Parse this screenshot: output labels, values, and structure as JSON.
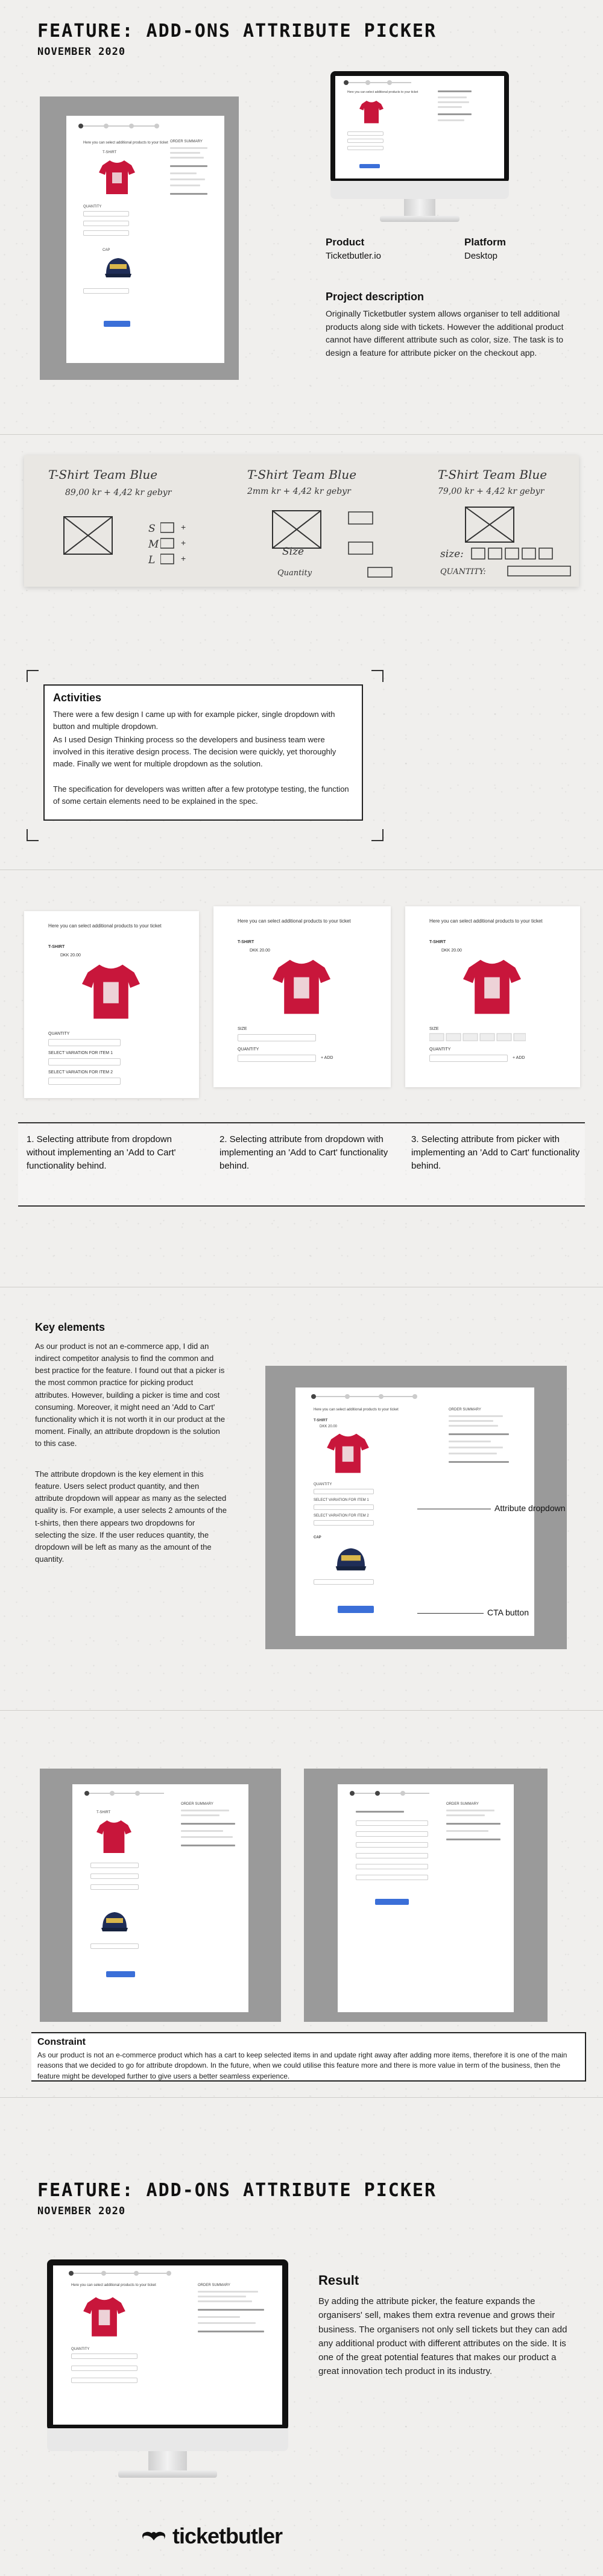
{
  "header": {
    "title": "FEATURE: ADD-ONS ATTRIBUTE PICKER",
    "date": "NOVEMBER 2020"
  },
  "mock": {
    "prompt": "Here you can select additional products to your ticket",
    "product_tshirt": "T-SHIRT",
    "product_tshirt_price": "DKK 20.00",
    "product_cap": "CAP",
    "quantity_label": "QUANTITY",
    "size_label": "SIZE",
    "select_variation": "SELECT VARIATION FOR ITEM 1",
    "select_variation_2": "SELECT VARIATION FOR ITEM 2",
    "add_button": "+ ADD",
    "order_summary": "ORDER SUMMARY"
  },
  "meta": {
    "product_label": "Product",
    "product_value": "Ticketbutler.io",
    "platform_label": "Platform",
    "platform_value": "Desktop"
  },
  "project": {
    "heading": "Project description",
    "text": "Originally Ticketbutler system allows organiser to tell additional products along side with tickets. However the additional product cannot have different attribute such as color, size. The task is to design a feature for attribute picker on the checkout app."
  },
  "sketches": [
    {
      "title": "T-Shirt Team Blue",
      "sub": "89,00 kr + 4,42 kr gebyr",
      "labels": [
        "S",
        "M",
        "L"
      ]
    },
    {
      "title": "T-Shirt Team Blue",
      "sub": "2mm kr + 4,42 kr gebyr",
      "labels": [
        "Size",
        "Quantity"
      ]
    },
    {
      "title": "T-Shirt Team Blue",
      "sub": "79,00 kr + 4,42 kr gebyr",
      "labels": [
        "size:",
        "QUANTITY:"
      ]
    }
  ],
  "activities": {
    "heading": "Activities",
    "p1": "There were a few design I came up with for example picker, single dropdown with button and multiple dropdown.",
    "p2": "As I used Design Thinking process so the developers and business team were involved in this iterative design process. The decision were quickly, yet thoroughly made. Finally we went for multiple dropdown as the solution.",
    "p3": "The specification for developers was written after a few prototype testing, the function of some certain elements need to be explained in the spec."
  },
  "options": [
    "1. Selecting attribute from dropdown without implementing an 'Add to Cart' functionality behind.",
    "2. Selecting attribute from dropdown with implementing an 'Add to Cart' functionality behind.",
    "3. Selecting attribute from picker with implementing an 'Add to Cart' functionality behind."
  ],
  "key_elements": {
    "heading": "Key elements",
    "p1": "As our product is not an e-commerce app, I did an indirect competitor analysis to find the common and best practice for the feature. I found out that a picker is the most common practice for picking product attributes. However, building a picker is time and cost consuming. Moreover, it might need an 'Add to Cart' functionality which it is not worth it in our product at the moment. Finally, an attribute dropdown is the solution to this case.",
    "p2": "The attribute dropdown is the key element in this feature. Users select product quantity, and then attribute dropdown will appear as many as the selected quality is. For example, a user selects 2 amounts of the t-shirts, then there appears two dropdowns for selecting the size. If the user reduces quantity, the dropdown will be left as many as the amount of the quantity.",
    "annot_dropdown": "Attribute dropdown",
    "annot_cta": "CTA button"
  },
  "constraint": {
    "heading": "Constraint",
    "text": "As our product is not an e-commerce product which has a cart to keep selected items in and update right away after adding more items, therefore it is one of the main reasons that we decided to go for attribute dropdown. In the future, when we could utilise this feature more and there is more value in term of the business, then the feature might be developed further to give users a better seamless experience."
  },
  "footer": {
    "title": "FEATURE: ADD-ONS ATTRIBUTE PICKER",
    "date": "NOVEMBER 2020"
  },
  "result": {
    "heading": "Result",
    "text": "By adding the attribute picker, the feature expands the organisers' sell, makes them extra revenue and grows their business. The organisers not only sell tickets but they can add any additional product with different attributes on the side. It is one of the great potential features that makes our product a great innovation tech product in its industry."
  },
  "brand": {
    "logo_text": "ticketbutler"
  },
  "colors": {
    "accent_blue": "#3b6fd8",
    "shirt_red": "#c8163b",
    "cap_navy": "#1f2d57",
    "frame_gray": "#9a9a9a"
  }
}
